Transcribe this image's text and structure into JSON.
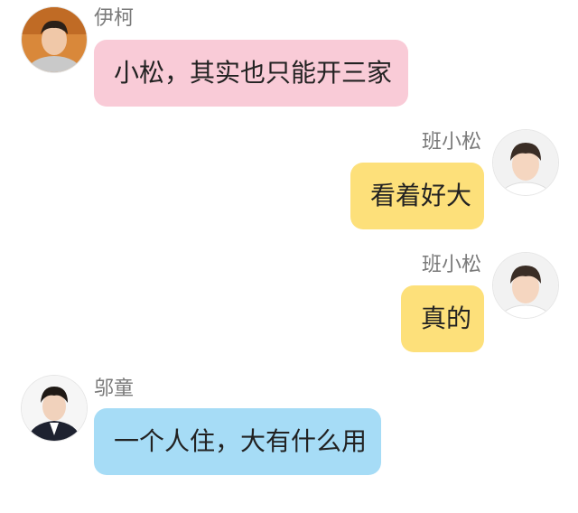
{
  "colors": {
    "bubble_pink": "#f9cbd7",
    "bubble_yellow": "#fde07a",
    "bubble_blue": "#a6dcf6",
    "name_text": "#7a7a7a",
    "background": "#ffffff"
  },
  "messages": [
    {
      "sender": "伊柯",
      "text": "小松，其实也只能开三家",
      "side": "left",
      "avatar_icon": "person-photo-icon"
    },
    {
      "sender": "班小松",
      "text": "看着好大",
      "side": "right",
      "avatar_icon": "person-photo-icon"
    },
    {
      "sender": "班小松",
      "text": "真的",
      "side": "right",
      "avatar_icon": "person-photo-icon"
    },
    {
      "sender": "邬童",
      "text": "一个人住，大有什么用",
      "side": "left",
      "avatar_icon": "person-photo-icon"
    }
  ]
}
